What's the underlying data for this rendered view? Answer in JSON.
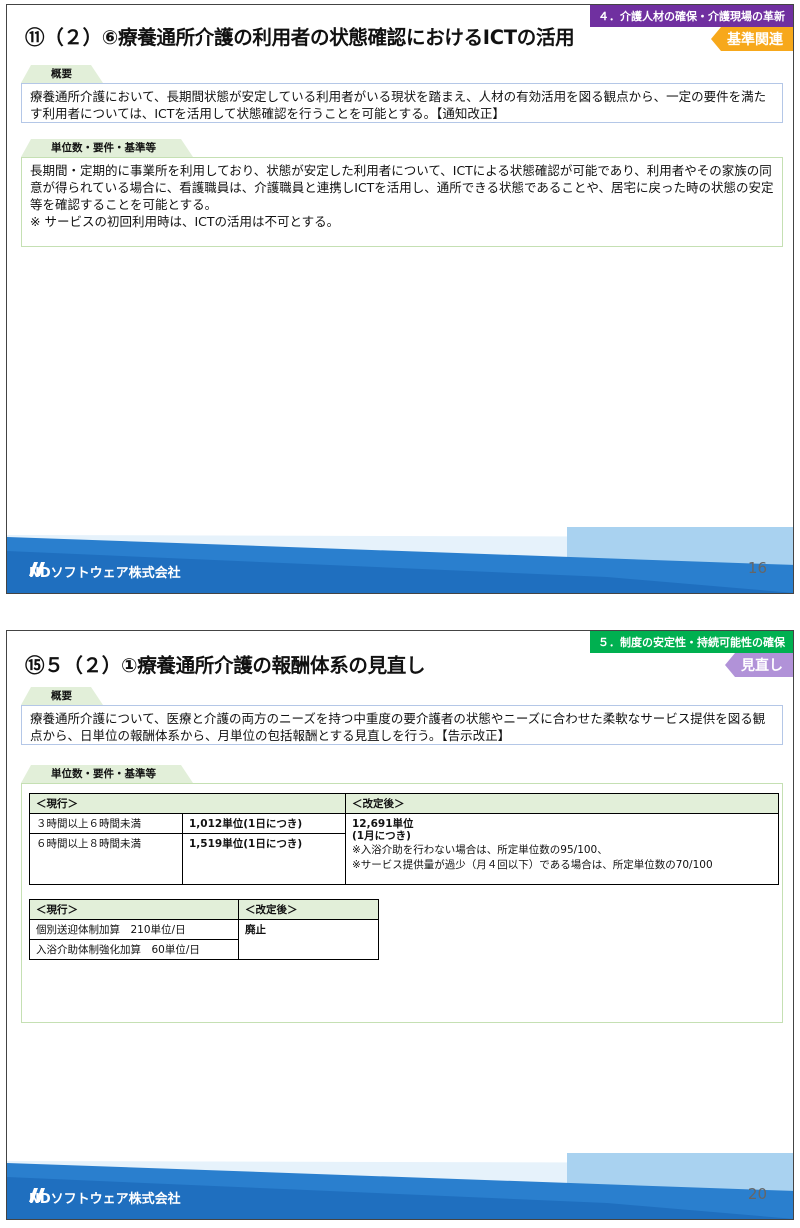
{
  "slide1": {
    "title": "⑪（２）⑥療養通所介護の利用者の状態確認におけるICTの活用",
    "category": "４．介護人材の確保・介護現場の革新",
    "tag": "基準関連",
    "overview_label": "概要",
    "overview_text": "療養通所介護において、長期間状態が安定している利用者がいる現状を踏まえ、人材の有効活用を図る観点から、一定の要件を満たす利用者については、ICTを活用して状態確認を行うことを可能とする。【通知改正】",
    "requirements_label": "単位数・要件・基準等",
    "requirements_text": "長期間・定期的に事業所を利用しており、状態が安定した利用者について、ICTによる状態確認が可能であり、利用者やその家族の同意が得られている場合に、看護職員は、介護職員と連携しICTを活用し、通所できる状態であることや、居宅に戻った時の状態の安定等を確認することを可能とする。\n※ サービスの初回利用時は、ICTの活用は不可とする。",
    "page": "16"
  },
  "slide2": {
    "title": "⑮５（２）①療養通所介護の報酬体系の見直し",
    "category": "５．制度の安定性・持続可能性の確保",
    "tag": "見直し",
    "overview_label": "概要",
    "overview_text": "療養通所介護について、医療と介護の両方のニーズを持つ中重度の要介護者の状態やニーズに合わせた柔軟なサービス提供を図る観点から、日単位の報酬体系から、月単位の包括報酬とする見直しを行う。【告示改正】",
    "requirements_label": "単位数・要件・基準等",
    "table1": {
      "header_current": "＜現行＞",
      "header_revised": "＜改定後＞",
      "rows": [
        {
          "label": "３時間以上６時間未満",
          "value": "1,012単位(1日につき)"
        },
        {
          "label": "６時間以上８時間未満",
          "value": "1,519単位(1日につき)"
        }
      ],
      "revised_value": "12,691単位",
      "revised_unit": "(1月につき)",
      "revised_note1": "※入浴介助を行わない場合は、所定単位数の95/100、",
      "revised_note2": "※サービス提供量が過少（月４回以下）である場合は、所定単位数の70/100"
    },
    "table2": {
      "header_current": "＜現行＞",
      "header_revised": "＜改定後＞",
      "rows": [
        {
          "label": "個別送迎体制加算　210単位/日"
        },
        {
          "label": "入浴介助体制強化加算　60単位/日"
        }
      ],
      "revised_value": "廃止"
    },
    "page": "20"
  },
  "footer": {
    "company": "NDソフトウェア株式会社"
  },
  "colors": {
    "footer_blue": "#1f6fbf",
    "footer_light": "#a9d2f0",
    "purple": "#7030a0",
    "green": "#00b050",
    "orange": "#f7a81b",
    "violet": "#b192d8"
  }
}
